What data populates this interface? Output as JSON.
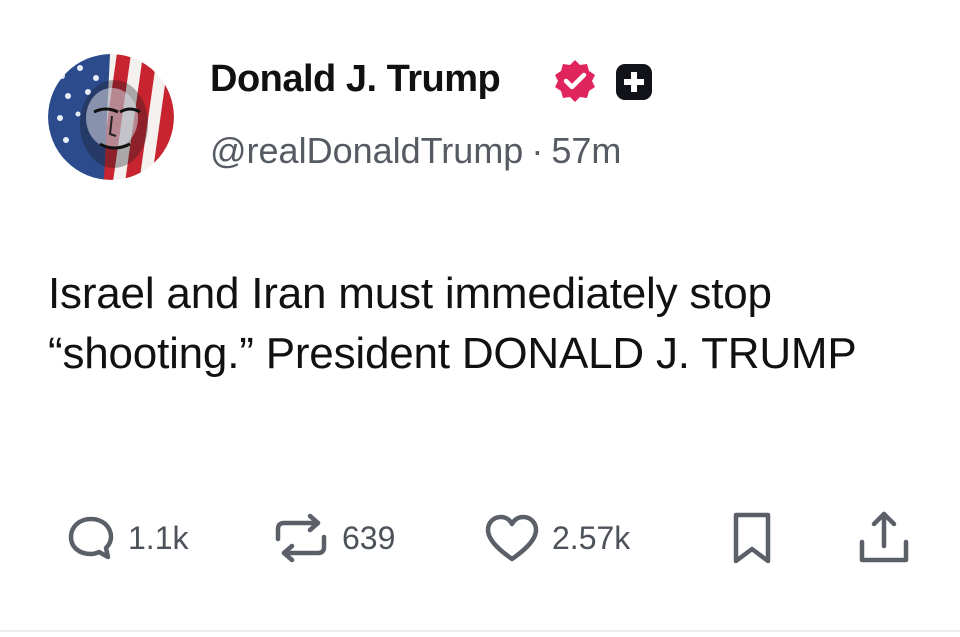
{
  "author": {
    "display_name": "Donald J. Trump",
    "handle": "@realDonaldTrump",
    "separator": "·",
    "time_ago": "57m",
    "avatar": "flag-face-portrait",
    "verified_icon": "verified-check-icon",
    "verified_color": "#e0245e",
    "plus_icon": "plus-square-icon"
  },
  "post": {
    "text": "Israel and Iran must immediately stop “shooting.” President DONALD J. TRUMP"
  },
  "actions": {
    "reply": {
      "icon": "comment-bubble-icon",
      "count": "1.1k"
    },
    "repost": {
      "icon": "repost-arrows-icon",
      "count": "639"
    },
    "like": {
      "icon": "heart-icon",
      "count": "2.57k"
    },
    "bookmark": {
      "icon": "bookmark-icon"
    },
    "share": {
      "icon": "share-upload-icon"
    }
  }
}
